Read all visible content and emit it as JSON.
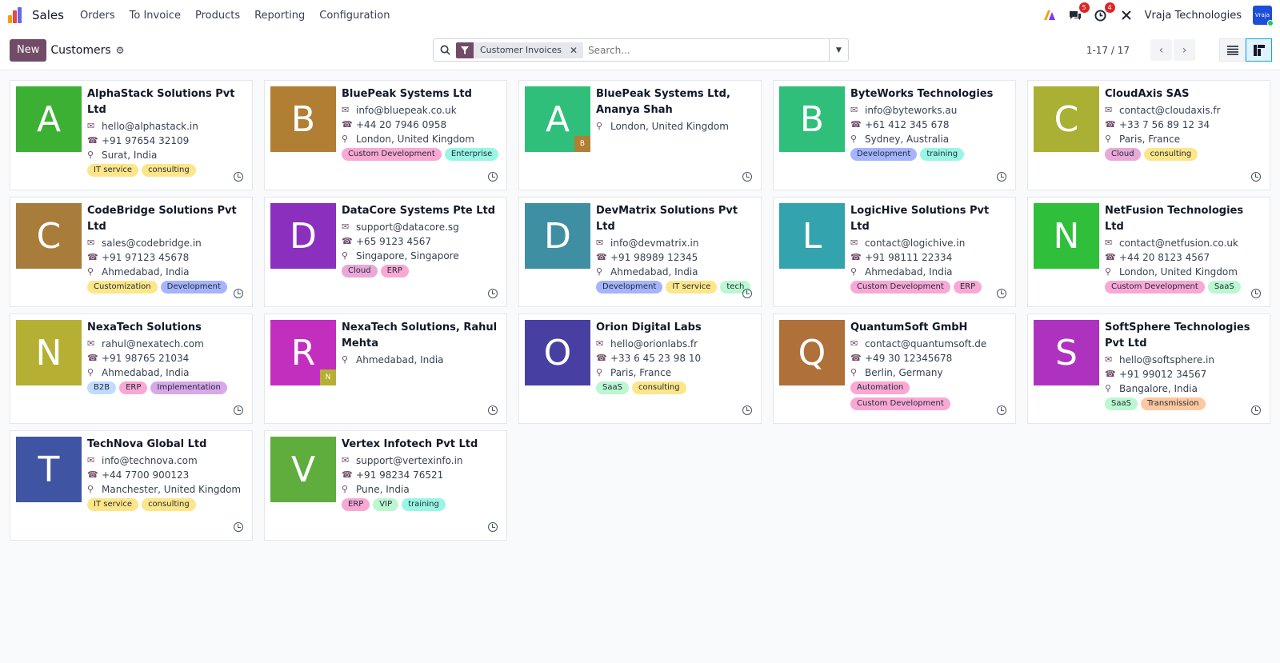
{
  "navbar": {
    "app_name": "Sales",
    "menu": [
      "Orders",
      "To Invoice",
      "Products",
      "Reporting",
      "Configuration"
    ],
    "messages_count": "5",
    "activities_count": "4",
    "company": "Vraja Technologies",
    "user_avatar_text": "Vraja"
  },
  "control": {
    "new_label": "New",
    "breadcrumb": "Customers",
    "facet": "Customer Invoices",
    "search_placeholder": "Search...",
    "pager": "1-17 / 17"
  },
  "tag_colors": {
    "IT service": "#fde68a",
    "consulting": "#fde68a",
    "Custom Development": "#f9a8d4",
    "Enterprise": "#99f6e4",
    "Development": "#a5b4fc",
    "training": "#99f6e4",
    "Cloud": "#e9a8d9",
    "Customization": "#fde68a",
    "ERP": "#f9a8d4",
    "tech": "#bbf7d0",
    "SaaS": "#bbf7d0",
    "B2B": "#bfdbfe",
    "Implementation": "#d8a8e8",
    "Automation": "#f9a8d4",
    "Transmission": "#fdc8a0",
    "VIP": "#bbf7d0"
  },
  "customers": [
    {
      "initial": "A",
      "color": "#3cb033",
      "name": "AlphaStack Solutions Pvt Ltd",
      "email": "hello@alphastack.in",
      "phone": "+91 97654 32109",
      "location": "Surat, India",
      "tags": [
        "IT service",
        "consulting"
      ]
    },
    {
      "initial": "B",
      "color": "#b07f33",
      "name": "BluePeak Systems Ltd",
      "email": "info@bluepeak.co.uk",
      "phone": "+44 20 7946 0958",
      "location": "London, United Kingdom",
      "tags": [
        "Custom Development",
        "Enterprise"
      ]
    },
    {
      "initial": "A",
      "color": "#2fbf7a",
      "name": "BluePeak Systems Ltd, Ananya Shah",
      "email": "",
      "phone": "",
      "location": "London, United Kingdom",
      "tags": [],
      "sub_initial": "B",
      "sub_color": "#b07f33"
    },
    {
      "initial": "B",
      "color": "#2fbf7a",
      "name": "ByteWorks Technologies",
      "email": "info@byteworks.au",
      "phone": "+61 412 345 678",
      "location": "Sydney, Australia",
      "tags": [
        "Development",
        "training"
      ]
    },
    {
      "initial": "C",
      "color": "#a9b033",
      "name": "CloudAxis SAS",
      "email": "contact@cloudaxis.fr",
      "phone": "+33 7 56 89 12 34",
      "location": "Paris, France",
      "tags": [
        "Cloud",
        "consulting"
      ]
    },
    {
      "initial": "C",
      "color": "#a87d3c",
      "name": "CodeBridge Solutions Pvt Ltd",
      "email": "sales@codebridge.in",
      "phone": "+91 97123 45678",
      "location": "Ahmedabad, India",
      "tags": [
        "Customization",
        "Development"
      ]
    },
    {
      "initial": "D",
      "color": "#8b2fbf",
      "name": "DataCore Systems Pte Ltd",
      "email": "support@datacore.sg",
      "phone": "+65 9123 4567",
      "location": "Singapore, Singapore",
      "tags": [
        "Cloud",
        "ERP"
      ]
    },
    {
      "initial": "D",
      "color": "#3f8fa3",
      "name": "DevMatrix Solutions Pvt Ltd",
      "email": "info@devmatrix.in",
      "phone": "+91 98989 12345",
      "location": "Ahmedabad, India",
      "tags": [
        "Development",
        "IT service",
        "tech"
      ]
    },
    {
      "initial": "L",
      "color": "#33a3ad",
      "name": "LogicHive Solutions Pvt Ltd",
      "email": "contact@logichive.in",
      "phone": "+91 98111 22334",
      "location": "Ahmedabad, India",
      "tags": [
        "Custom Development",
        "ERP"
      ]
    },
    {
      "initial": "N",
      "color": "#2fbf3a",
      "name": "NetFusion Technologies Ltd",
      "email": "contact@netfusion.co.uk",
      "phone": "+44 20 8123 4567",
      "location": "London, United Kingdom",
      "tags": [
        "Custom Development",
        "SaaS"
      ]
    },
    {
      "initial": "N",
      "color": "#b5b033",
      "name": "NexaTech Solutions",
      "email": "rahul@nexatech.com",
      "phone": "+91 98765 21034",
      "location": "Ahmedabad, India",
      "tags": [
        "B2B",
        "ERP",
        "Implementation"
      ]
    },
    {
      "initial": "R",
      "color": "#c22fbf",
      "name": "NexaTech Solutions, Rahul Mehta",
      "email": "",
      "phone": "",
      "location": "Ahmedabad, India",
      "tags": [],
      "sub_initial": "N",
      "sub_color": "#b5b033"
    },
    {
      "initial": "O",
      "color": "#483fa3",
      "name": "Orion Digital Labs",
      "email": "hello@orionlabs.fr",
      "phone": "+33 6 45 23 98 10",
      "location": "Paris, France",
      "tags": [
        "SaaS",
        "consulting"
      ]
    },
    {
      "initial": "Q",
      "color": "#b0703a",
      "name": "QuantumSoft GmbH",
      "email": "contact@quantumsoft.de",
      "phone": "+49 30 12345678",
      "location": "Berlin, Germany",
      "tags": [
        "Automation",
        "Custom Development"
      ]
    },
    {
      "initial": "S",
      "color": "#ad33bf",
      "name": "SoftSphere Technologies Pvt Ltd",
      "email": "hello@softsphere.in",
      "phone": "+91 99012 34567",
      "location": "Bangalore, India",
      "tags": [
        "SaaS",
        "Transmission"
      ]
    },
    {
      "initial": "T",
      "color": "#3f55a3",
      "name": "TechNova Global Ltd",
      "email": "info@technova.com",
      "phone": "+44 7700 900123",
      "location": "Manchester, United Kingdom",
      "tags": [
        "IT service",
        "consulting"
      ]
    },
    {
      "initial": "V",
      "color": "#5fad3c",
      "name": "Vertex Infotech Pvt Ltd",
      "email": "support@vertexinfo.in",
      "phone": "+91 98234 76521",
      "location": "Pune, India",
      "tags": [
        "ERP",
        "VIP",
        "training"
      ]
    }
  ]
}
